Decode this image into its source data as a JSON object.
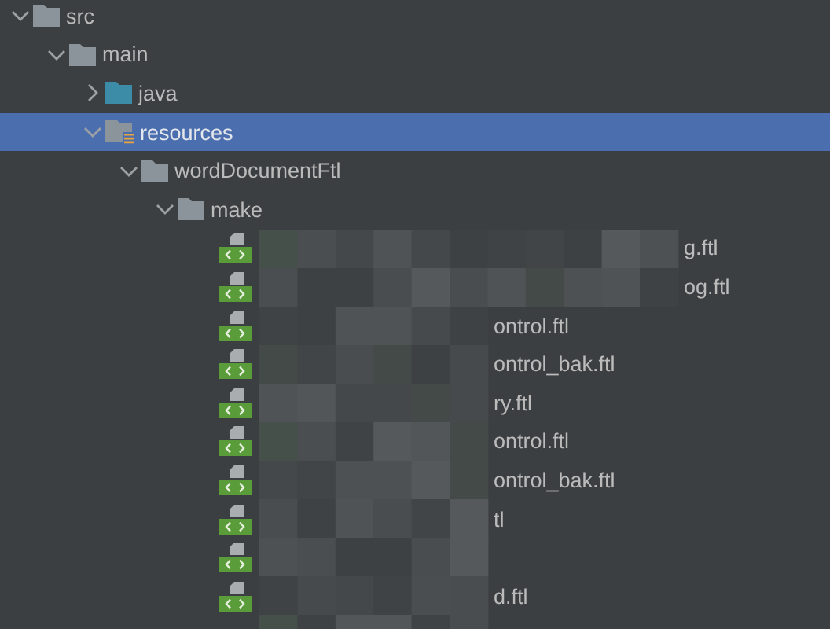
{
  "tree": [
    {
      "name": "src",
      "kind": "folder",
      "expanded": true,
      "selected": false,
      "children": [
        {
          "name": "main",
          "kind": "folder",
          "expanded": true,
          "selected": false,
          "children": [
            {
              "name": "java",
              "kind": "source-folder",
              "expanded": false,
              "selected": false
            },
            {
              "name": "resources",
              "kind": "resource-folder",
              "expanded": true,
              "selected": true,
              "children": [
                {
                  "name": "wordDocumentFtl",
                  "kind": "folder",
                  "expanded": true,
                  "selected": false,
                  "children": [
                    {
                      "name": "make",
                      "kind": "folder",
                      "expanded": true,
                      "selected": false,
                      "children": [
                        {
                          "name": "g.ftl",
                          "kind": "ftl-file",
                          "selected": false
                        },
                        {
                          "name": "og.ftl",
                          "kind": "ftl-file",
                          "selected": false
                        },
                        {
                          "name": "ontrol.ftl",
                          "kind": "ftl-file",
                          "selected": false
                        },
                        {
                          "name": "ontrol_bak.ftl",
                          "kind": "ftl-file",
                          "selected": false
                        },
                        {
                          "name": "ry.ftl",
                          "kind": "ftl-file",
                          "selected": false
                        },
                        {
                          "name": "ontrol.ftl",
                          "kind": "ftl-file",
                          "selected": false
                        },
                        {
                          "name": "ontrol_bak.ftl",
                          "kind": "ftl-file",
                          "selected": false
                        },
                        {
                          "name": "tl",
                          "kind": "ftl-file",
                          "selected": false
                        },
                        {
                          "kind": "ftl-file",
                          "selected": false
                        },
                        {
                          "name": "d.ftl",
                          "kind": "ftl-file",
                          "selected": false
                        }
                      ]
                    }
                  ]
                }
              ]
            }
          ]
        }
      ]
    }
  ]
}
